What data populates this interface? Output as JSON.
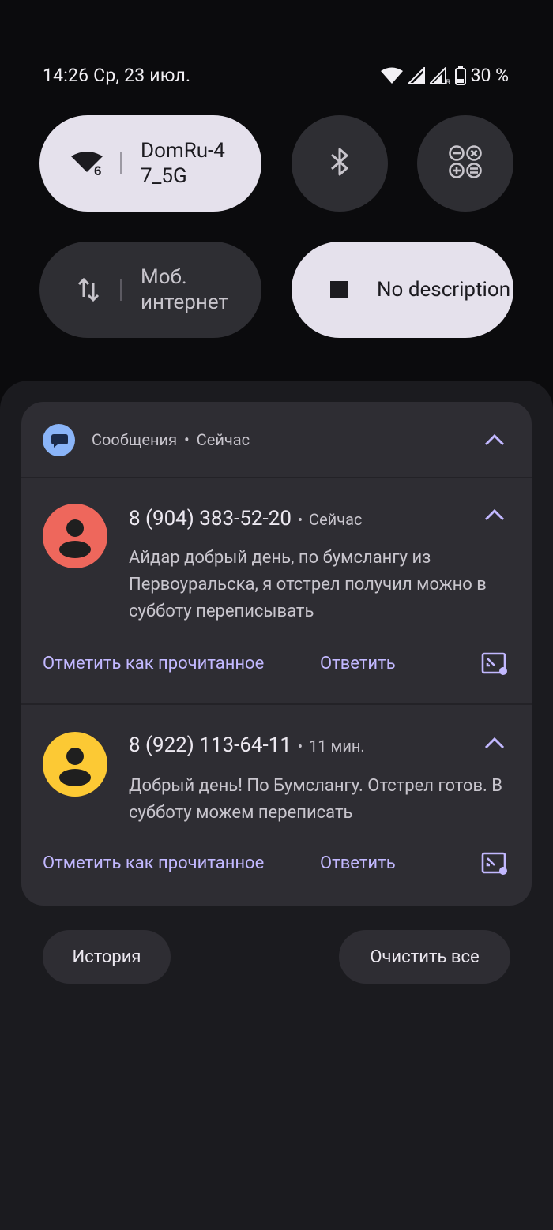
{
  "status_bar": {
    "time_date": "14:26  Ср, 23 июл.",
    "battery_percent": "30 %",
    "icons": [
      "wifi-icon",
      "cell-signal-icon",
      "cell-signal-roaming-icon",
      "battery-icon"
    ]
  },
  "quick_settings": {
    "wifi": {
      "label": "DomRu-4\n7_5G",
      "icon": "wifi-6-icon",
      "active": true
    },
    "bluetooth": {
      "icon": "bluetooth-icon",
      "active": false
    },
    "calculator": {
      "icon": "calculator-icon",
      "active": false
    },
    "mobile_data": {
      "label": "Моб.\nинтернет",
      "icon": "data-transfer-icon",
      "active": false
    },
    "no_description": {
      "label": "No\ndescription",
      "icon": "stop-square-icon",
      "active": true
    }
  },
  "notification": {
    "app_name": "Сообщения",
    "separator": "•",
    "app_time": "Сейчас",
    "messages": [
      {
        "sender": "8 (904) 383-52-20",
        "time": "Сейчас",
        "body": "Айдар добрый день, по бумслангу из Первоуральска, я отстрел получил можно в субботу переписывать",
        "avatar_color": "#ee675c",
        "mark_read": "Отметить как прочитанное",
        "reply": "Ответить"
      },
      {
        "sender": "8 (922) 113-64-11",
        "time": "11 мин.",
        "body": "Добрый день! По Бумслангу. Отстрел готов. В субботу можем переписать",
        "avatar_color": "#fcc934",
        "mark_read": "Отметить как прочитанное",
        "reply": "Ответить"
      }
    ]
  },
  "footer": {
    "history": "История",
    "clear_all": "Очистить все"
  },
  "colors": {
    "accent": "#c2b8ff",
    "tile_on": "#e5e1ec",
    "tile_off": "#2e2e33",
    "shade": "#1b1b1f",
    "card": "#2e2d33"
  }
}
